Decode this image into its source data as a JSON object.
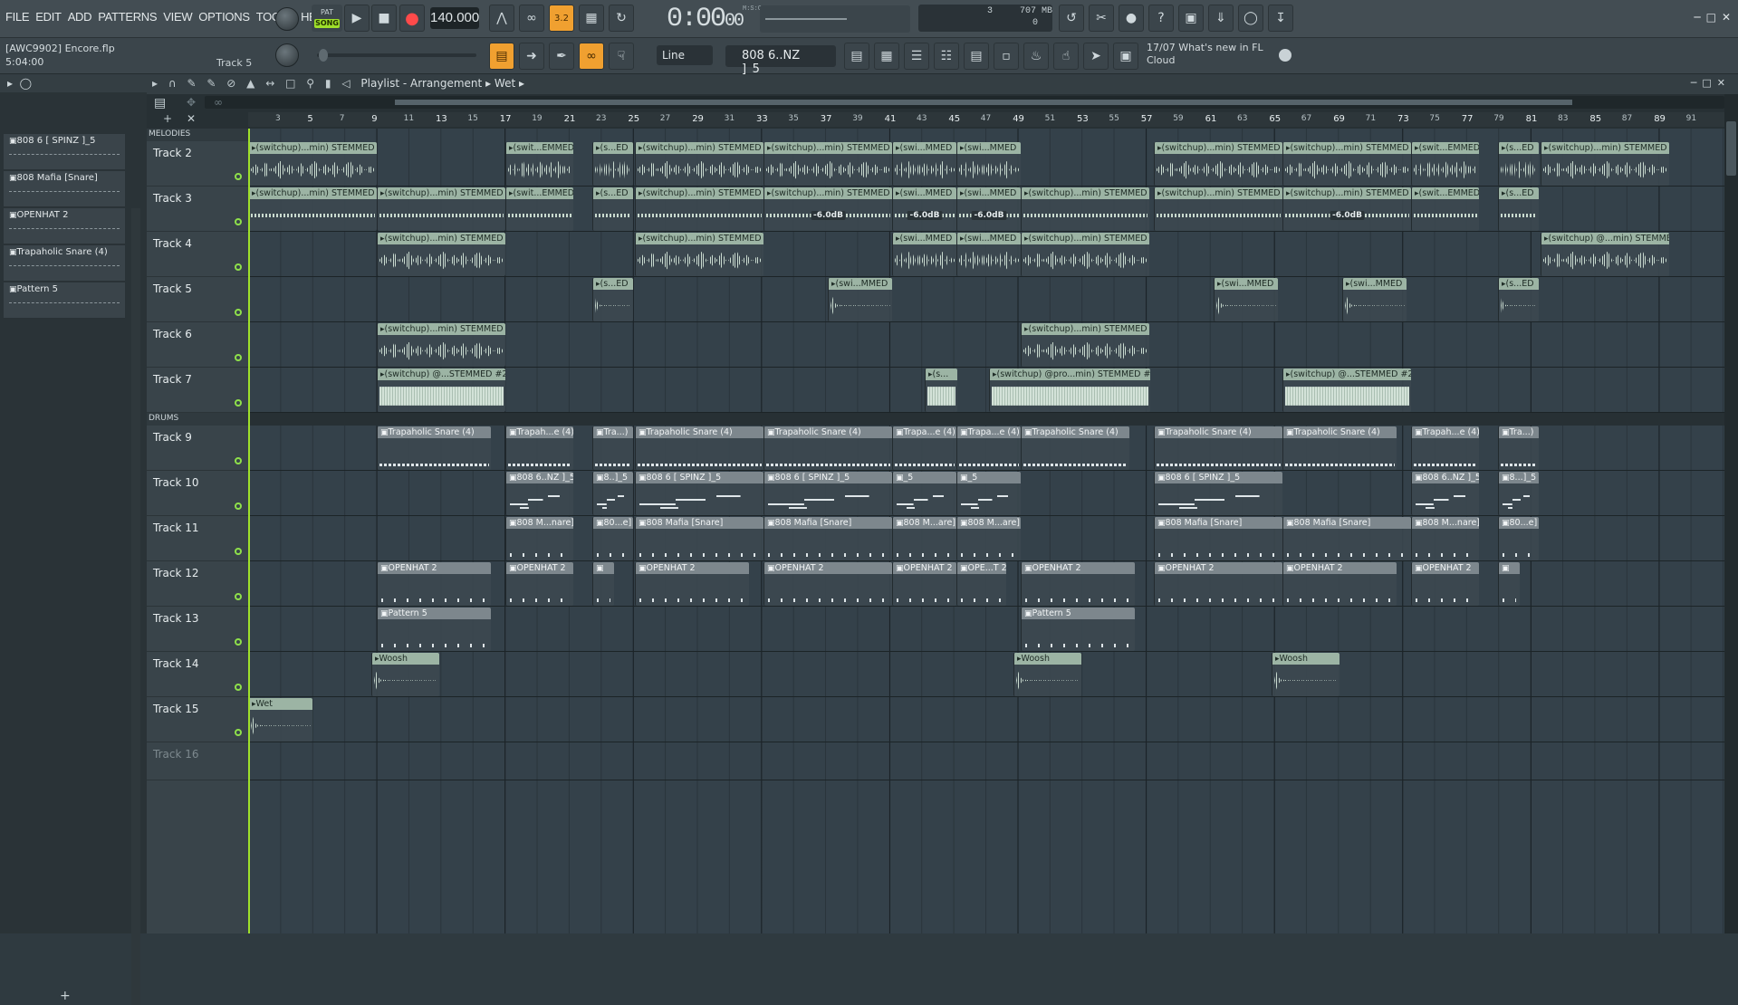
{
  "menu": [
    "FILE",
    "EDIT",
    "ADD",
    "PATTERNS",
    "VIEW",
    "OPTIONS",
    "TOOLS",
    "HELP"
  ],
  "transport": {
    "pat_label": "PAT",
    "song_label": "SONG",
    "tempo": "140.000",
    "time": "0:00",
    "time_sub": "00",
    "time_format": "M:S:CS",
    "beat_indicator": "3.2"
  },
  "cpu": {
    "cpu_count": "3",
    "memory": "707 MB",
    "polyphony": "0"
  },
  "project": {
    "id": "[AWC9902]",
    "file": "Encore.flp",
    "length": "5:04:00",
    "hint": "Track 5"
  },
  "toolbar": {
    "snap": "Line",
    "pattern": "808 6..NZ ]_5"
  },
  "news": {
    "date": "17/07",
    "headline": "What's new in FL",
    "sub": "Cloud"
  },
  "playlist": {
    "title": "Playlist - Arrangement",
    "breadcrumb": "Wet"
  },
  "browser": {
    "channels": [
      "808 6 [ SPINZ ]_5",
      "808 Mafia [Snare]",
      "OPENHAT 2",
      "Trapaholic Snare (4)",
      "Pattern 5"
    ]
  },
  "ruler": [
    "3",
    "5",
    "7",
    "9",
    "11",
    "13",
    "15",
    "17",
    "19",
    "21",
    "23",
    "25",
    "27",
    "29",
    "31",
    "33",
    "35",
    "37",
    "39",
    "41",
    "43",
    "45",
    "47",
    "49",
    "51",
    "53",
    "55",
    "57",
    "59",
    "61",
    "63",
    "65",
    "67",
    "69",
    "71",
    "73",
    "75",
    "77",
    "79",
    "81",
    "83",
    "85",
    "87",
    "89",
    "91"
  ],
  "sections": {
    "melodies": "MELODIES",
    "drums": "DRUMS"
  },
  "tracks": [
    "Track 2",
    "Track 3",
    "Track 4",
    "Track 5",
    "Track 6",
    "Track 7",
    "Track 9",
    "Track 10",
    "Track 11",
    "Track 12",
    "Track 13",
    "Track 14",
    "Track 15",
    "Track 16"
  ],
  "clips": {
    "stem": "(switchup)...min) STEMMED",
    "swit": "(swit...EMMED",
    "sed": "(s...ED",
    "swi": "(swi...MMED",
    "swimmed": "(swi...MMED",
    "pro": "(switchup) @...min) STEMMED",
    "st2": "(switchup) @...STEMMED #2",
    "pro2": "(switchup) @pro...min) STEMMED #2",
    "s_": "(s...",
    "db": "-6.0dB",
    "trap": "Trapaholic Snare (4)",
    "trapah": "Trapah...e (4)",
    "tra": "Tra...)",
    "trapa": "Trapa...e (4)",
    "b808nz": "808 6..NZ ]_5",
    "b808": "808 6 [ SPINZ ]_5",
    "b8": "8..]_5",
    "b8b": "8...]_5",
    "b8c": "_5",
    "mafia": "808 Mafia [Snare]",
    "mafiash": "808 M...nare]",
    "b80e": "80...e]",
    "mare": "808 M...are]",
    "openhat": "OPENHAT 2",
    "opet": "OPE...T 2",
    "pattern5": "Pattern 5",
    "woosh": "Woosh",
    "wet": "Wet"
  }
}
